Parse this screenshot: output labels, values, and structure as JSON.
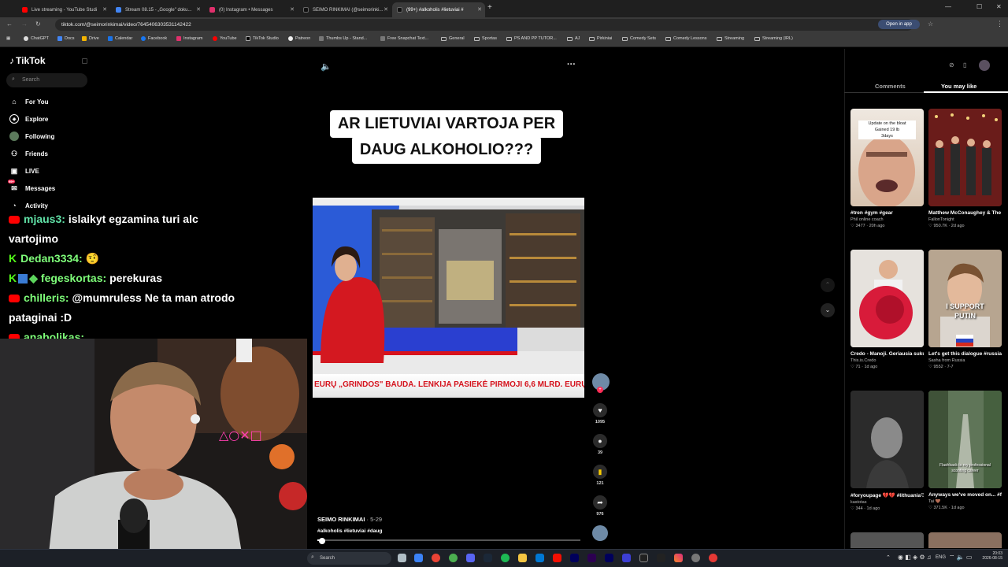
{
  "browser": {
    "tabs": [
      {
        "label": "Live streaming - YouTube Studi",
        "color": "#ff0000"
      },
      {
        "label": "Stream 08.15 - „Google\" doku...",
        "color": "#4285f4"
      },
      {
        "label": "(0) Instagram • Messages",
        "color": "#e1306c"
      },
      {
        "label": "SEIMO RINKIMAI (@seimorinki...",
        "color": "#111111"
      },
      {
        "label": "(99+) #alkoholis #lietuviai #",
        "color": "#111111"
      }
    ],
    "url": "tiktok.com/@seimorinkimai/video/7645406303531142422",
    "open_in_app": "Open in app",
    "bookmarks": [
      "ChatGPT",
      "Docs",
      "Drive",
      "Calendar",
      "Facebook",
      "Instagram",
      "YouTube",
      "TikTok Studio",
      "Patreon",
      "Thumbs Up - Stand...",
      "Free Snapchat Text...",
      "General",
      "Sportas",
      "PS AND PP TUTOR...",
      "AJ",
      "Pirkiniai",
      "Comedy Sets",
      "Comedy Lessons",
      "Streaming",
      "Streaming (IRL)"
    ]
  },
  "tiktok": {
    "logo": "TikTok",
    "search_placeholder": "Search",
    "nav": [
      {
        "label": "For You",
        "icon": "home-icon"
      },
      {
        "label": "Explore",
        "icon": "compass-icon"
      },
      {
        "label": "Following",
        "icon": "following-icon"
      },
      {
        "label": "Friends",
        "icon": "friends-icon"
      },
      {
        "label": "LIVE",
        "icon": "live-icon"
      },
      {
        "label": "Messages",
        "icon": "messages-icon"
      },
      {
        "label": "Activity",
        "icon": "activity-icon"
      }
    ]
  },
  "chat": [
    {
      "user": "mjaus3:",
      "text": "islaikyt egzamina turi alc"
    },
    {
      "user": "",
      "text": "vartojimo"
    },
    {
      "user": "Dedan3334:",
      "text": "🤨"
    },
    {
      "user": "fegeskortas:",
      "text": "perekuras"
    },
    {
      "user": "chilleris:",
      "text": "@mumruless Ne ta man atrodo"
    },
    {
      "user": "",
      "text": "pataginai :D"
    },
    {
      "user": "anabolikas:",
      "text": ""
    }
  ],
  "video": {
    "title_line1": "AR LIETUVIAI VARTOJA PER",
    "title_line2": "DAUG ALKOHOLIO???",
    "ticker": "EURŲ „GRINDOS\" BAUDA.  LENKIJA PASIEKĖ PIRMOJI 6,6 MLRD. EURŲ I",
    "author": "SEIMO RINKIMAI",
    "date": " · 5-29",
    "hashtags": "#alkoholis #lietuviai #daug",
    "progress": 0.02,
    "likes": "1095",
    "comments": "39",
    "saves": "121",
    "shares": "976"
  },
  "right_panel": {
    "tab_comments": "Comments",
    "tab_you_may_like": "You may like",
    "cards": [
      {
        "overlay": "Update on the bloat\nGained 19 lb\n3days",
        "title": "#tren #gym #gear",
        "author": "Phil online coach",
        "stats": "♡ 3477 · 20h ago"
      },
      {
        "overlay": "",
        "title": "Matthew McConaughey & The Last Bison...",
        "author": "FallonTonight",
        "stats": "♡ 950.7K · 2d ago"
      },
      {
        "overlay": "",
        "title": "Credo - Manoji. Geriausia sukurta dain...",
        "author": "This.is.Credo",
        "stats": "♡ 71 · 1d ago"
      },
      {
        "overlay": "I SUPPORT\nPUTIN",
        "title": "Let's get this dialogue #russia #russian",
        "author": "Sasha from Russia",
        "stats": "♡ 9552 · 7-7"
      },
      {
        "overlay": "",
        "title": "#foryoupage 💔💔 #lithuania♡ #whydotas",
        "author": "kastotas",
        "stats": "♡ 344 · 1d ago"
      },
      {
        "overlay": "Flashback to my professional scooting career",
        "title": "Anyways we've moved on... #fyp #fyp...",
        "author": "Tai 🤎",
        "stats": "♡ 371.5K · 1d ago"
      }
    ]
  },
  "taskbar": {
    "search": "Search",
    "lang": "ENG",
    "time": "20:03",
    "date": "2026-08-15"
  }
}
